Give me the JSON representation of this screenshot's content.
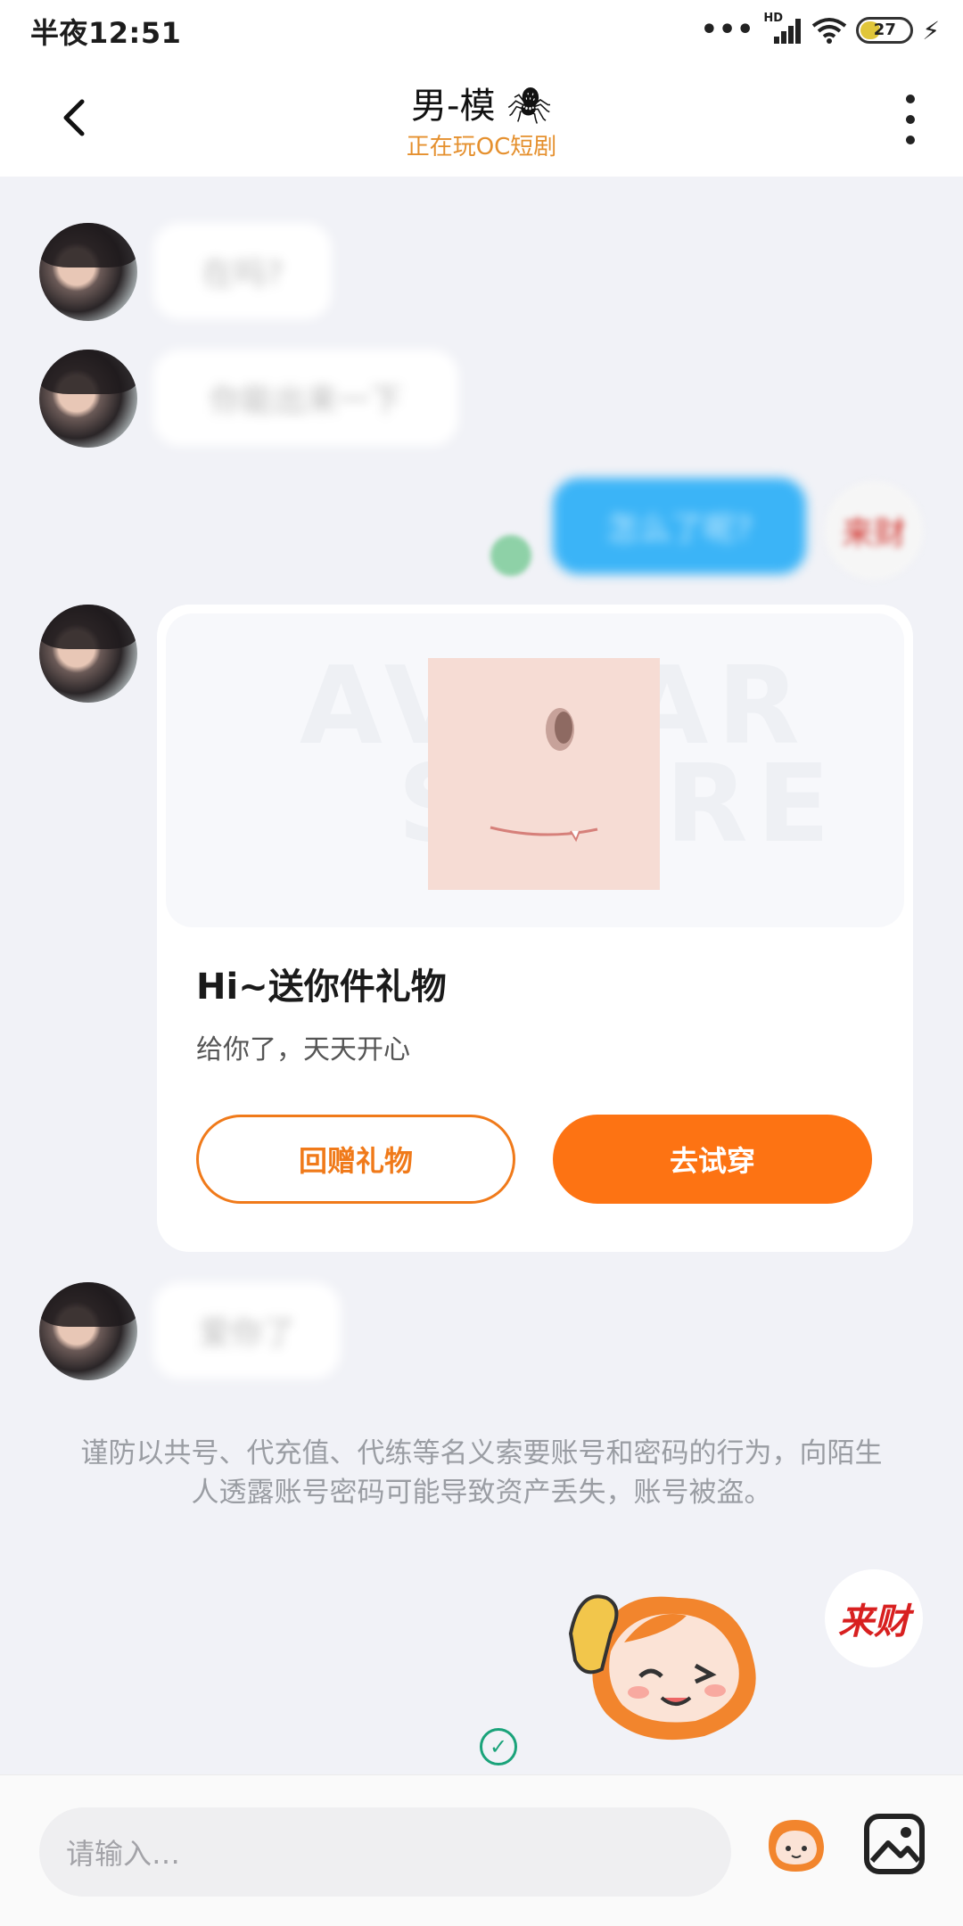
{
  "status_bar": {
    "time": "半夜12:51",
    "signal_label": "HD",
    "battery": "27"
  },
  "header": {
    "title": "男-模",
    "title_emoji": "🕷",
    "subtitle": "正在玩OC短剧"
  },
  "messages": [
    {
      "from": "other",
      "text": "在吗?"
    },
    {
      "from": "other",
      "text": "你能出来一下"
    },
    {
      "from": "self",
      "text": "怎么了呢?"
    },
    {
      "from": "other",
      "text": "爱你了"
    }
  ],
  "self_avatar_text": "来财",
  "gift_card": {
    "watermark": [
      "AVATAR",
      "STORE"
    ],
    "title": "Hi~送你件礼物",
    "description": "给你了，天天开心",
    "return_button": "回赠礼物",
    "try_button": "去试穿"
  },
  "warning": "谨防以共号、代充值、代练等名义索要账号和密码的行为，向陌生人透露账号密码可能导致资产丢失，账号被盗。",
  "badge_text": "来财",
  "input": {
    "placeholder": "请输入…"
  },
  "colors": {
    "accent_orange": "#fd7313",
    "subtitle_orange": "#e5902e",
    "self_bubble": "#3bb4f7",
    "background": "#f1f2f7"
  },
  "icons": [
    "back-arrow-icon",
    "more-vertical-icon",
    "wifi-icon",
    "battery-icon",
    "emoji-sticker-icon",
    "image-icon",
    "check-icon"
  ]
}
